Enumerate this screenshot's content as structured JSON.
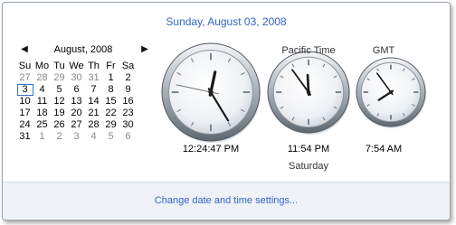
{
  "header": {
    "date_text": "Sunday, August 03, 2008"
  },
  "calendar": {
    "prev_icon": "left-arrow-icon",
    "next_icon": "right-arrow-icon",
    "month_label": "August, 2008",
    "weekdays": [
      "Su",
      "Mo",
      "Tu",
      "We",
      "Th",
      "Fr",
      "Sa"
    ],
    "weeks": [
      [
        "27",
        "28",
        "29",
        "30",
        "31",
        "1",
        "2"
      ],
      [
        "3",
        "4",
        "5",
        "6",
        "7",
        "8",
        "9"
      ],
      [
        "10",
        "11",
        "12",
        "13",
        "14",
        "15",
        "16"
      ],
      [
        "17",
        "18",
        "19",
        "20",
        "21",
        "22",
        "23"
      ],
      [
        "24",
        "25",
        "26",
        "27",
        "28",
        "29",
        "30"
      ],
      [
        "31",
        "1",
        "2",
        "3",
        "4",
        "5",
        "6"
      ]
    ],
    "today": "3"
  },
  "clocks": [
    {
      "label": "",
      "time": "12:24:47 PM",
      "day": "",
      "hour": 12,
      "minute": 24,
      "second": 47
    },
    {
      "label": "Pacific Time",
      "time": "11:54 PM",
      "day": "Saturday",
      "hour": 11,
      "minute": 54,
      "second": 0
    },
    {
      "label": "GMT",
      "time": "7:54 AM",
      "day": "",
      "hour": 7,
      "minute": 54,
      "second": 0
    }
  ],
  "footer": {
    "link_text": "Change date and time settings..."
  },
  "colors": {
    "link": "#2f64c8",
    "today_border": "#3a75c4"
  }
}
